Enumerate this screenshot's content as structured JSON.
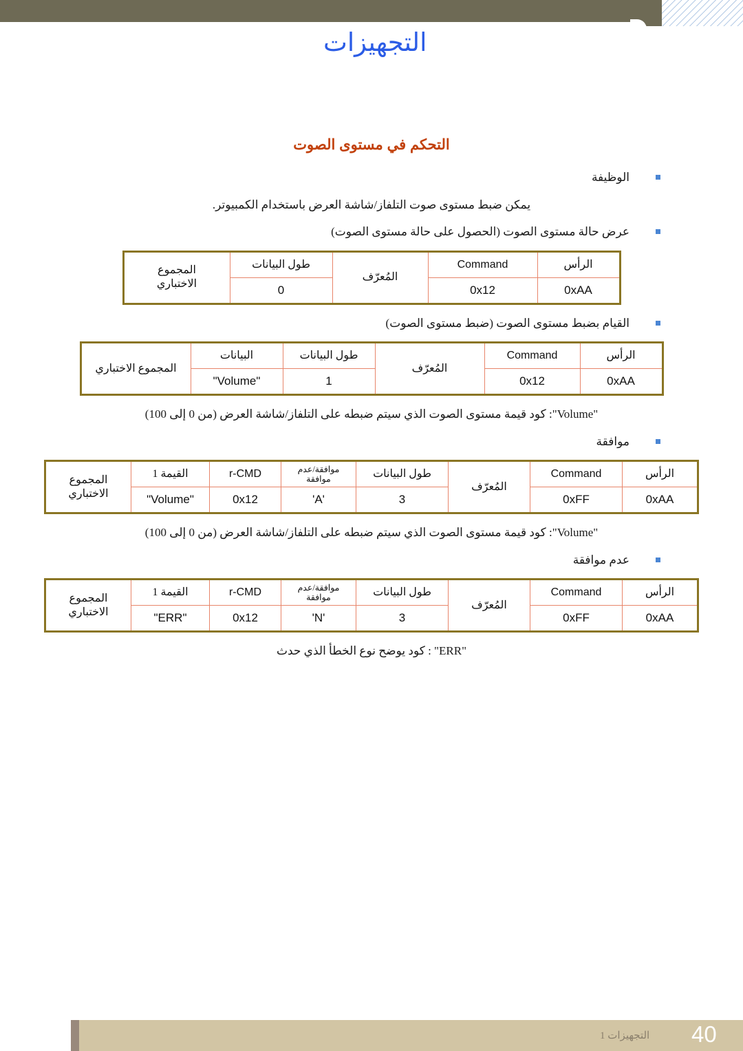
{
  "header": {
    "page_heading": "التجهيزات"
  },
  "section": {
    "title": "التحكم في مستوى الصوت"
  },
  "bullets": {
    "function": "الوظيفة",
    "function_desc": "يمكن ضبط مستوى صوت التلفاز/شاشة العرض باستخدام الكمبيوتر.",
    "get_state": "عرض حالة مستوى الصوت (الحصول على حالة مستوى الصوت)",
    "set_volume": "القيام بضبط مستوى الصوت (ضبط مستوى الصوت)",
    "ack": "موافقة",
    "nak": "عدم موافقة"
  },
  "notes": {
    "volume_note": "\"Volume\": كود قيمة مستوى الصوت الذي سيتم ضبطه على التلفاز/شاشة العرض (من 0 إلى 100)",
    "err_note": "\"ERR\" : كود يوضح نوع الخطأ الذي حدث"
  },
  "labels": {
    "header_cell": "الرأس",
    "command": "Command",
    "identifier": "المُعرّف",
    "data_length": "طول البيانات",
    "data": "البيانات",
    "checksum": "المجموع الاختباري",
    "checksum_line1": "المجموع",
    "checksum_line2": "الاختباري",
    "ack_nak_line1": "موافقة/عدم",
    "ack_nak_line2": "موافقة",
    "r_cmd": "r-CMD",
    "value1": "القيمة 1"
  },
  "tables": {
    "get_state": {
      "headers": [
        "الرأس",
        "Command",
        "المُعرّف",
        "طول البيانات",
        "المجموع الاختباري"
      ],
      "values": [
        "0xAA",
        "0x12",
        "",
        "0",
        ""
      ]
    },
    "set_volume": {
      "headers": [
        "الرأس",
        "Command",
        "المُعرّف",
        "طول البيانات",
        "البيانات",
        "المجموع الاختباري"
      ],
      "values": [
        "0xAA",
        "0x12",
        "",
        "1",
        "\"Volume\"",
        ""
      ]
    },
    "ack": {
      "headers": [
        "الرأس",
        "Command",
        "المُعرّف",
        "طول البيانات",
        "موافقة/عدم موافقة",
        "r-CMD",
        "القيمة 1",
        "المجموع الاختباري"
      ],
      "values": [
        "0xAA",
        "0xFF",
        "",
        "3",
        "'A'",
        "0x12",
        "\"Volume\"",
        ""
      ]
    },
    "nak": {
      "headers": [
        "الرأس",
        "Command",
        "المُعرّف",
        "طول البيانات",
        "موافقة/عدم موافقة",
        "r-CMD",
        "القيمة 1",
        "المجموع الاختباري"
      ],
      "values": [
        "0xAA",
        "0xFF",
        "",
        "3",
        "'N'",
        "0x12",
        "\"ERR\"",
        ""
      ]
    }
  },
  "footer": {
    "page_number": "40",
    "label": "التجهيزات 1"
  },
  "colors": {
    "heading_blue": "#2b5ce6",
    "section_orange": "#c2410c",
    "header_band": "#6e6a55",
    "footer_band": "#d2c5a4",
    "table_outer_border": "#8a7524",
    "table_inner_border": "#e8856a",
    "bullet_blue": "#4b86d4"
  }
}
